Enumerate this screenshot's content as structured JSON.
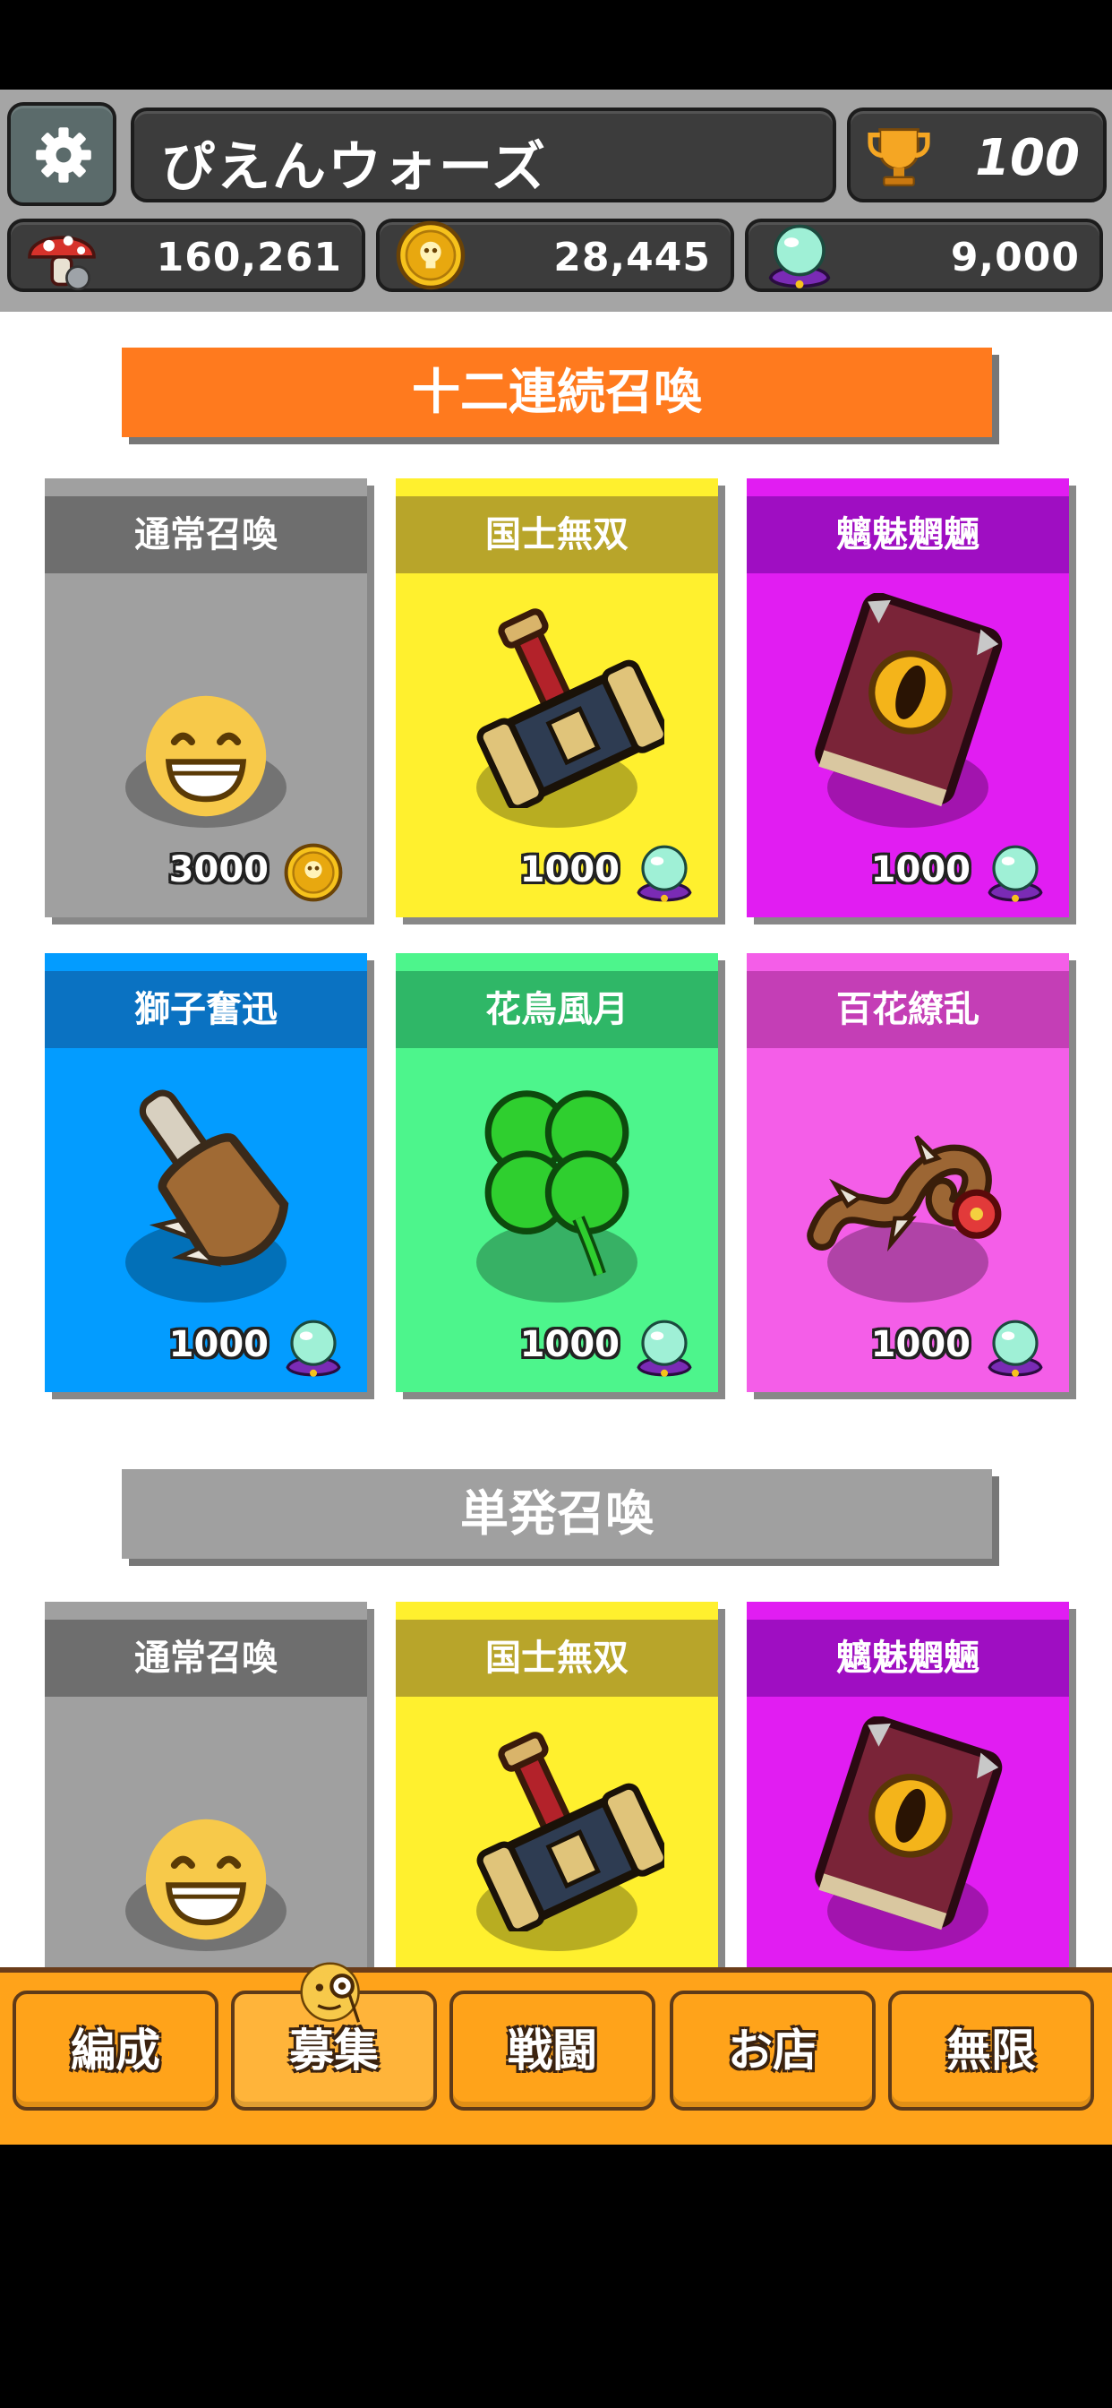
{
  "header": {
    "title": "ぴえんウォーズ",
    "trophy_count": "100",
    "resources": [
      {
        "icon": "mushroom-icon",
        "value": "160,261"
      },
      {
        "icon": "gold-coin-icon",
        "value": "28,445"
      },
      {
        "icon": "crystal-orb-icon",
        "value": "9,000"
      }
    ]
  },
  "sections": {
    "multi_title": "十二連続召喚",
    "single_title": "単発召喚"
  },
  "multi_cards": [
    {
      "label": "通常召喚",
      "price": "3000",
      "currency_icon": "gold-coin-icon",
      "item_icon": "grin-face-icon",
      "color": "#a0a0a0",
      "head": "#6e6e6e"
    },
    {
      "label": "国士無双",
      "price": "1000",
      "currency_icon": "crystal-orb-icon",
      "item_icon": "hammer-icon",
      "color": "#fff02e",
      "head": "#b8a52a"
    },
    {
      "label": "魑魅魍魎",
      "price": "1000",
      "currency_icon": "crystal-orb-icon",
      "item_icon": "spellbook-icon",
      "color": "#e11df2",
      "head": "#9f0ec2"
    },
    {
      "label": "獅子奮迅",
      "price": "1000",
      "currency_icon": "crystal-orb-icon",
      "item_icon": "bone-club-icon",
      "color": "#039cff",
      "head": "#0a72c2"
    },
    {
      "label": "花鳥風月",
      "price": "1000",
      "currency_icon": "crystal-orb-icon",
      "item_icon": "four-leaf-clover-icon",
      "color": "#4df58c",
      "head": "#2fb767"
    },
    {
      "label": "百花繚乱",
      "price": "1000",
      "currency_icon": "crystal-orb-icon",
      "item_icon": "thorn-vine-icon",
      "color": "#f45ee8",
      "head": "#c43eb6"
    }
  ],
  "single_cards": [
    {
      "label": "通常召喚",
      "item_icon": "grin-face-icon",
      "color": "#a0a0a0",
      "head": "#6e6e6e"
    },
    {
      "label": "国士無双",
      "item_icon": "hammer-icon",
      "color": "#fff02e",
      "head": "#b8a52a"
    },
    {
      "label": "魑魅魍魎",
      "item_icon": "spellbook-icon",
      "color": "#e11df2",
      "head": "#9f0ec2"
    }
  ],
  "nav": {
    "items": [
      "編成",
      "募集",
      "戦闘",
      "お店",
      "無限"
    ],
    "active_index": 1
  },
  "colors": {
    "header_bg": "#a5a5a5",
    "accent_orange": "#ff7a1e",
    "nav_orange": "#ffa31a"
  }
}
